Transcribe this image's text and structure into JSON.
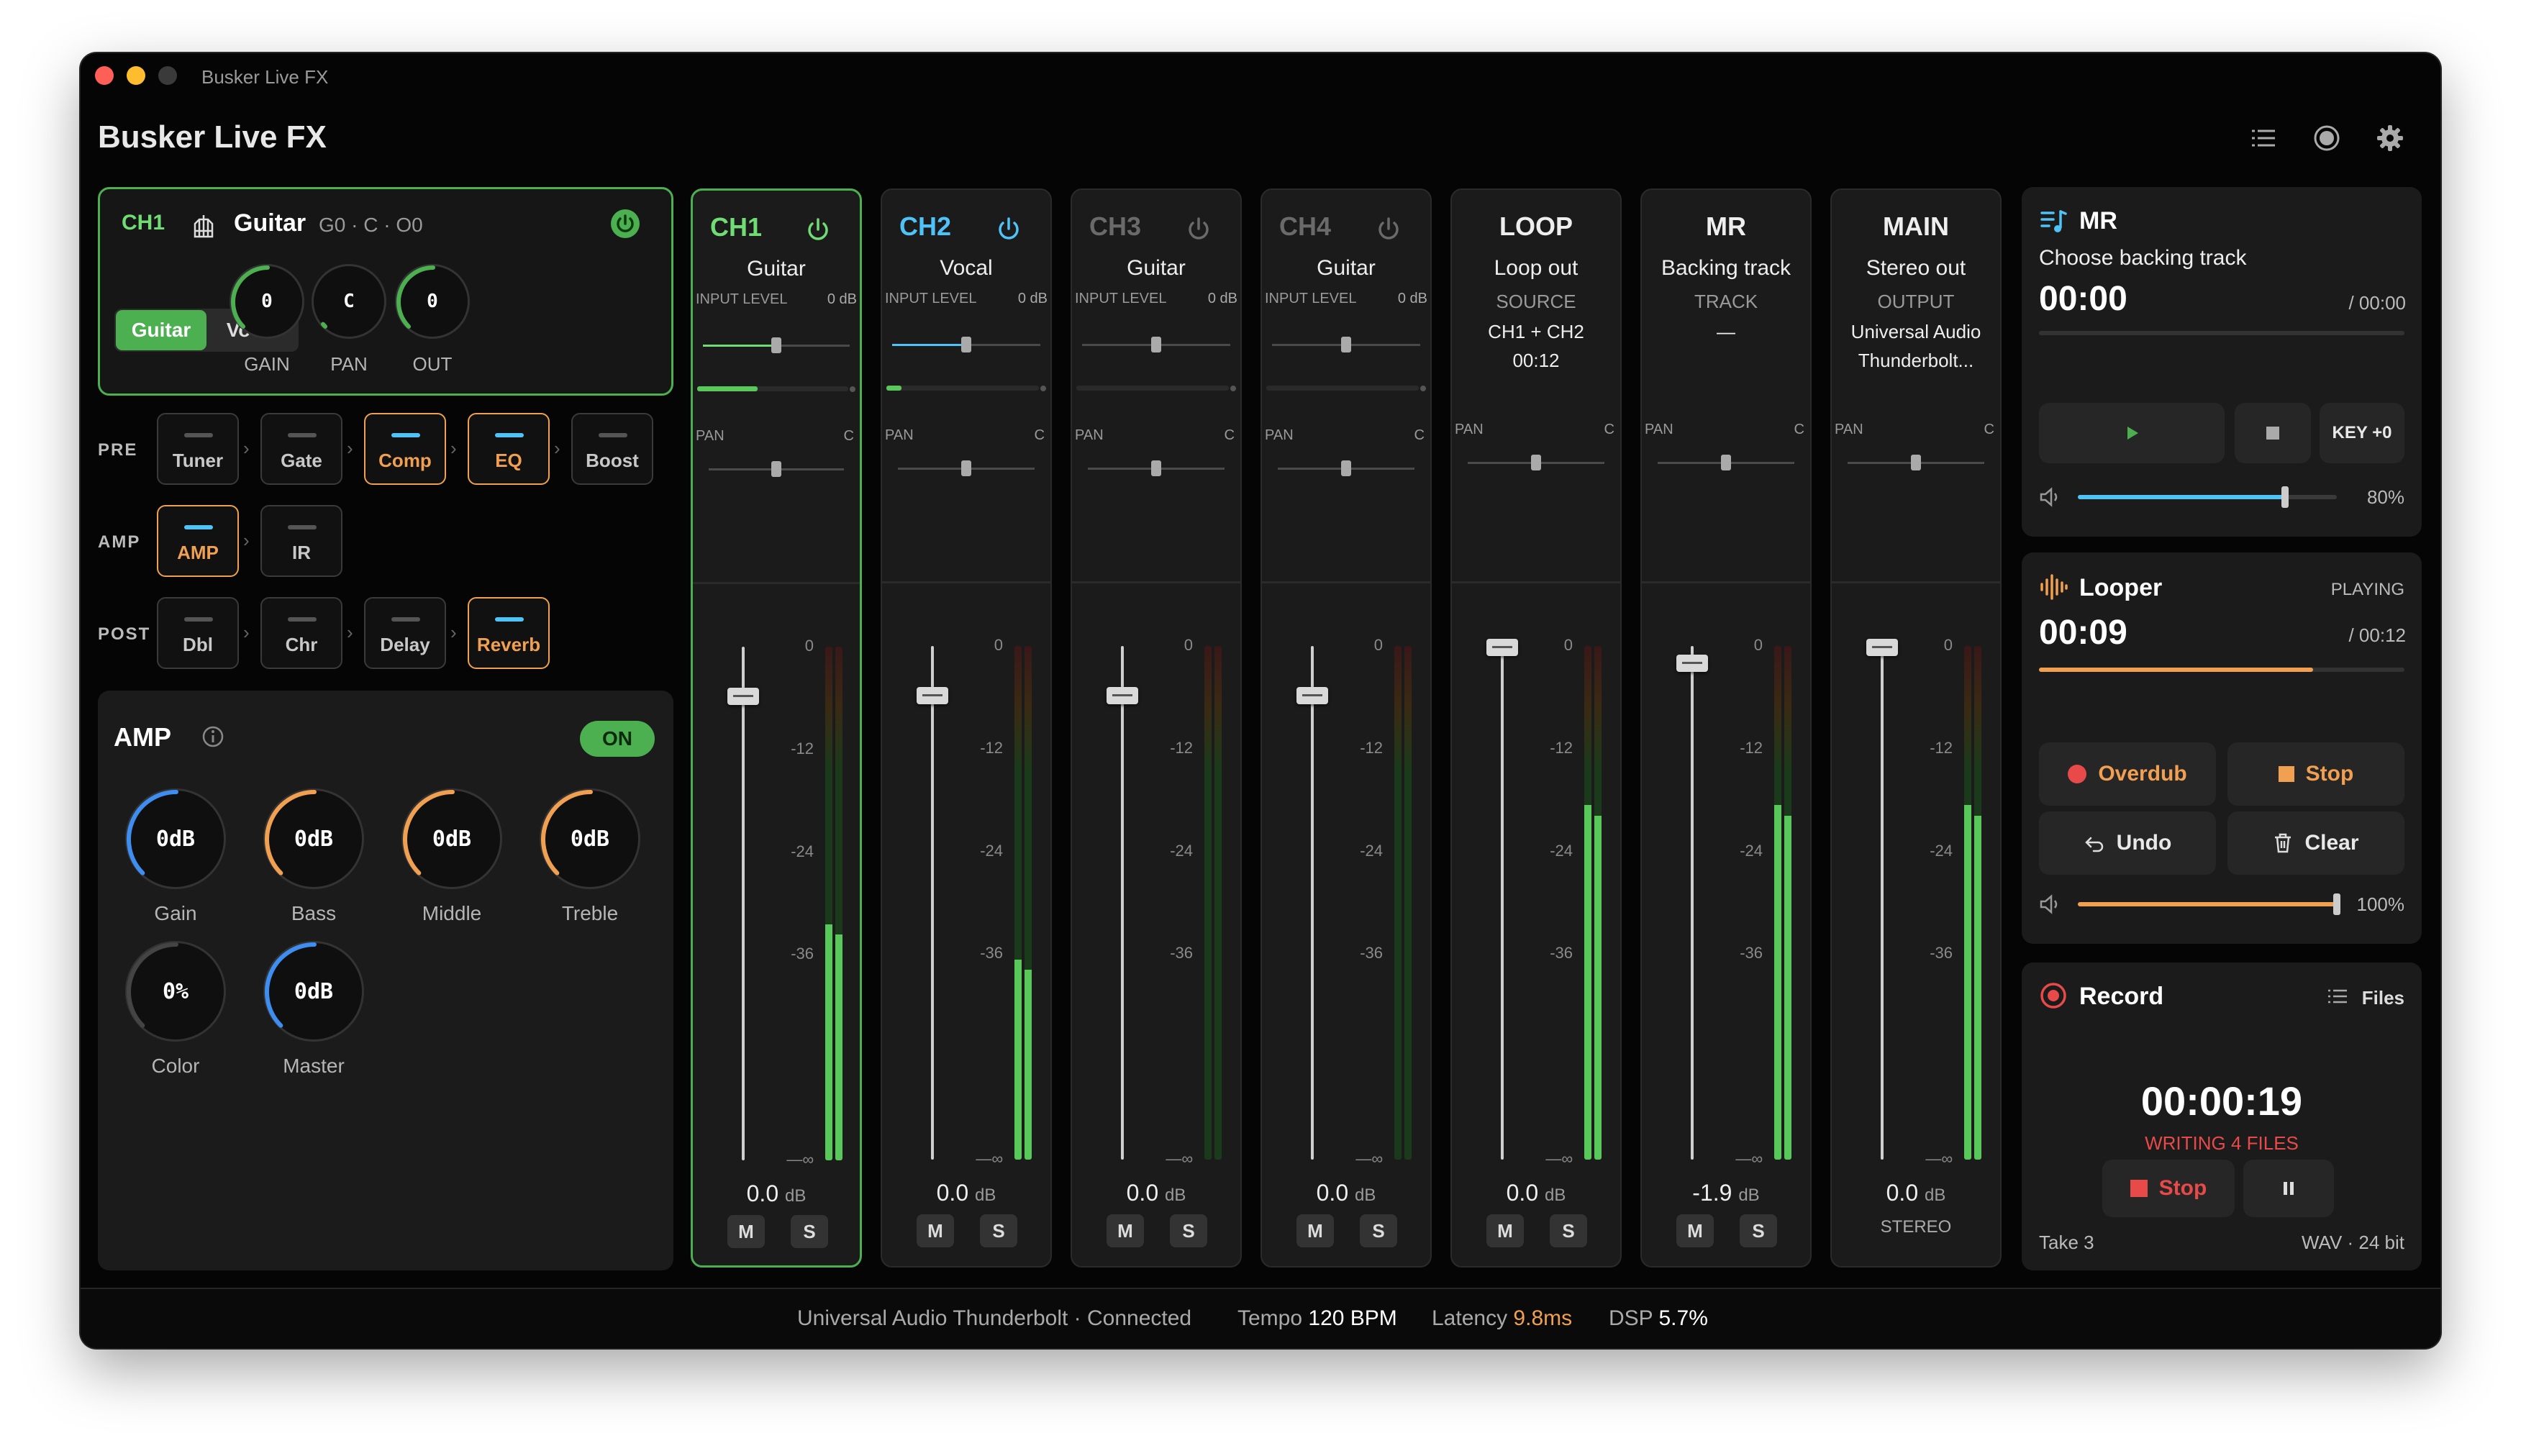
{
  "window": {
    "title": "Busker Live FX",
    "app_title": "Busker Live FX"
  },
  "toolbar": {
    "icons": [
      "list-icon",
      "record-circle-icon",
      "gear-icon"
    ]
  },
  "channel_editor": {
    "channel": "CH1",
    "name": "Guitar",
    "summary": "G0 · C · O0",
    "presets": [
      "Guitar",
      "Vocal"
    ],
    "active_preset": "Guitar",
    "knobs": [
      {
        "label": "GAIN",
        "value": "0"
      },
      {
        "label": "PAN",
        "value": "C"
      },
      {
        "label": "OUT",
        "value": "0"
      }
    ]
  },
  "chain": {
    "rows": [
      {
        "label": "PRE",
        "blocks": [
          {
            "name": "Tuner",
            "on": false
          },
          {
            "name": "Gate",
            "on": false
          },
          {
            "name": "Comp",
            "on": true
          },
          {
            "name": "EQ",
            "on": true
          },
          {
            "name": "Boost",
            "on": false
          }
        ]
      },
      {
        "label": "AMP",
        "blocks": [
          {
            "name": "AMP",
            "on": true
          },
          {
            "name": "IR",
            "on": false
          }
        ]
      },
      {
        "label": "POST",
        "blocks": [
          {
            "name": "Dbl",
            "on": false
          },
          {
            "name": "Chr",
            "on": false
          },
          {
            "name": "Delay",
            "on": false
          },
          {
            "name": "Reverb",
            "on": true
          }
        ]
      }
    ]
  },
  "amp": {
    "title": "AMP",
    "toggle": "ON",
    "knobs": [
      {
        "label": "Gain",
        "value": "0dB",
        "color": "#3d8ef0"
      },
      {
        "label": "Bass",
        "value": "0dB",
        "color": "#f0a050"
      },
      {
        "label": "Middle",
        "value": "0dB",
        "color": "#f0a050"
      },
      {
        "label": "Treble",
        "value": "0dB",
        "color": "#f0a050"
      },
      {
        "label": "Color",
        "value": "0%",
        "color": "#444444"
      },
      {
        "label": "Master",
        "value": "0dB",
        "color": "#3d8ef0"
      }
    ]
  },
  "mixer": {
    "scale": [
      "0",
      "-12",
      "-24",
      "-36",
      "—∞"
    ],
    "pan_label": "PAN",
    "pan_value": "C",
    "strips": [
      {
        "name": "CH1",
        "sub": "Guitar",
        "color": "#6fdc74",
        "info_label": "INPUT LEVEL",
        "info_value": "0 dB",
        "level": 0.4,
        "db": "0.0",
        "unit": "dB",
        "meter": 0.46,
        "fader": "0.0 dB"
      },
      {
        "name": "CH2",
        "sub": "Vocal",
        "color": "#4fc3f7",
        "info_label": "INPUT LEVEL",
        "info_value": "0 dB",
        "level": 0.1,
        "db": "0.0",
        "unit": "dB",
        "meter": 0.39,
        "fader": "0.0 dB"
      },
      {
        "name": "CH3",
        "sub": "Guitar",
        "color": "#6a6a6a",
        "info_label": "INPUT LEVEL",
        "info_value": "0 dB",
        "level": 0,
        "db": "0.0",
        "unit": "dB",
        "meter": 0,
        "fader": "0.0 dB"
      },
      {
        "name": "CH4",
        "sub": "Guitar",
        "color": "#6a6a6a",
        "info_label": "INPUT LEVEL",
        "info_value": "0 dB",
        "level": 0,
        "db": "0.0",
        "unit": "dB",
        "meter": 0,
        "fader": "0.0 dB"
      },
      {
        "name": "LOOP",
        "sub": "Loop out",
        "info_label": "SOURCE",
        "info_lines": [
          "CH1 + CH2",
          "00:12"
        ],
        "db": "0.0",
        "unit": "dB",
        "meter": 0.69
      },
      {
        "name": "MR",
        "sub": "Backing track",
        "info_label": "TRACK",
        "info_lines": [
          "—"
        ],
        "db": "-1.9",
        "unit": "dB",
        "meter": 0.69
      },
      {
        "name": "MAIN",
        "sub": "Stereo out",
        "info_label": "OUTPUT",
        "info_lines": [
          "Universal Audio",
          "Thunderbolt..."
        ],
        "db": "0.0",
        "unit": "dB",
        "meter": 0.69,
        "footer": "STEREO"
      }
    ],
    "mute_label": "M",
    "solo_label": "S"
  },
  "mr": {
    "title": "MR",
    "track": "Choose backing track",
    "time": "00:00",
    "total": "/ 00:00",
    "progress": 0,
    "key": "KEY +0",
    "volume": "80%",
    "volume_value": 0.8
  },
  "looper": {
    "title": "Looper",
    "state": "PLAYING",
    "time": "00:09",
    "total": "/ 00:12",
    "progress": 0.75,
    "overdub": "Overdub",
    "stop": "Stop",
    "undo": "Undo",
    "clear": "Clear",
    "volume": "100%",
    "volume_value": 1.0
  },
  "record": {
    "title": "Record",
    "files": "Files",
    "time": "00:00:19",
    "status": "WRITING 4 FILES",
    "stop": "Stop",
    "take": "Take 3",
    "format": "WAV · 24 bit"
  },
  "status": {
    "device": "Universal Audio Thunderbolt · Connected",
    "tempo_label": "Tempo",
    "tempo": "120 BPM",
    "latency_label": "Latency",
    "latency": "9.8ms",
    "dsp_label": "DSP",
    "dsp": "5.7%"
  },
  "colors": {
    "accent_green": "#4caf50",
    "accent_orange": "#f0a050",
    "accent_blue": "#4fc3f7",
    "record_red": "#e84a4a"
  }
}
